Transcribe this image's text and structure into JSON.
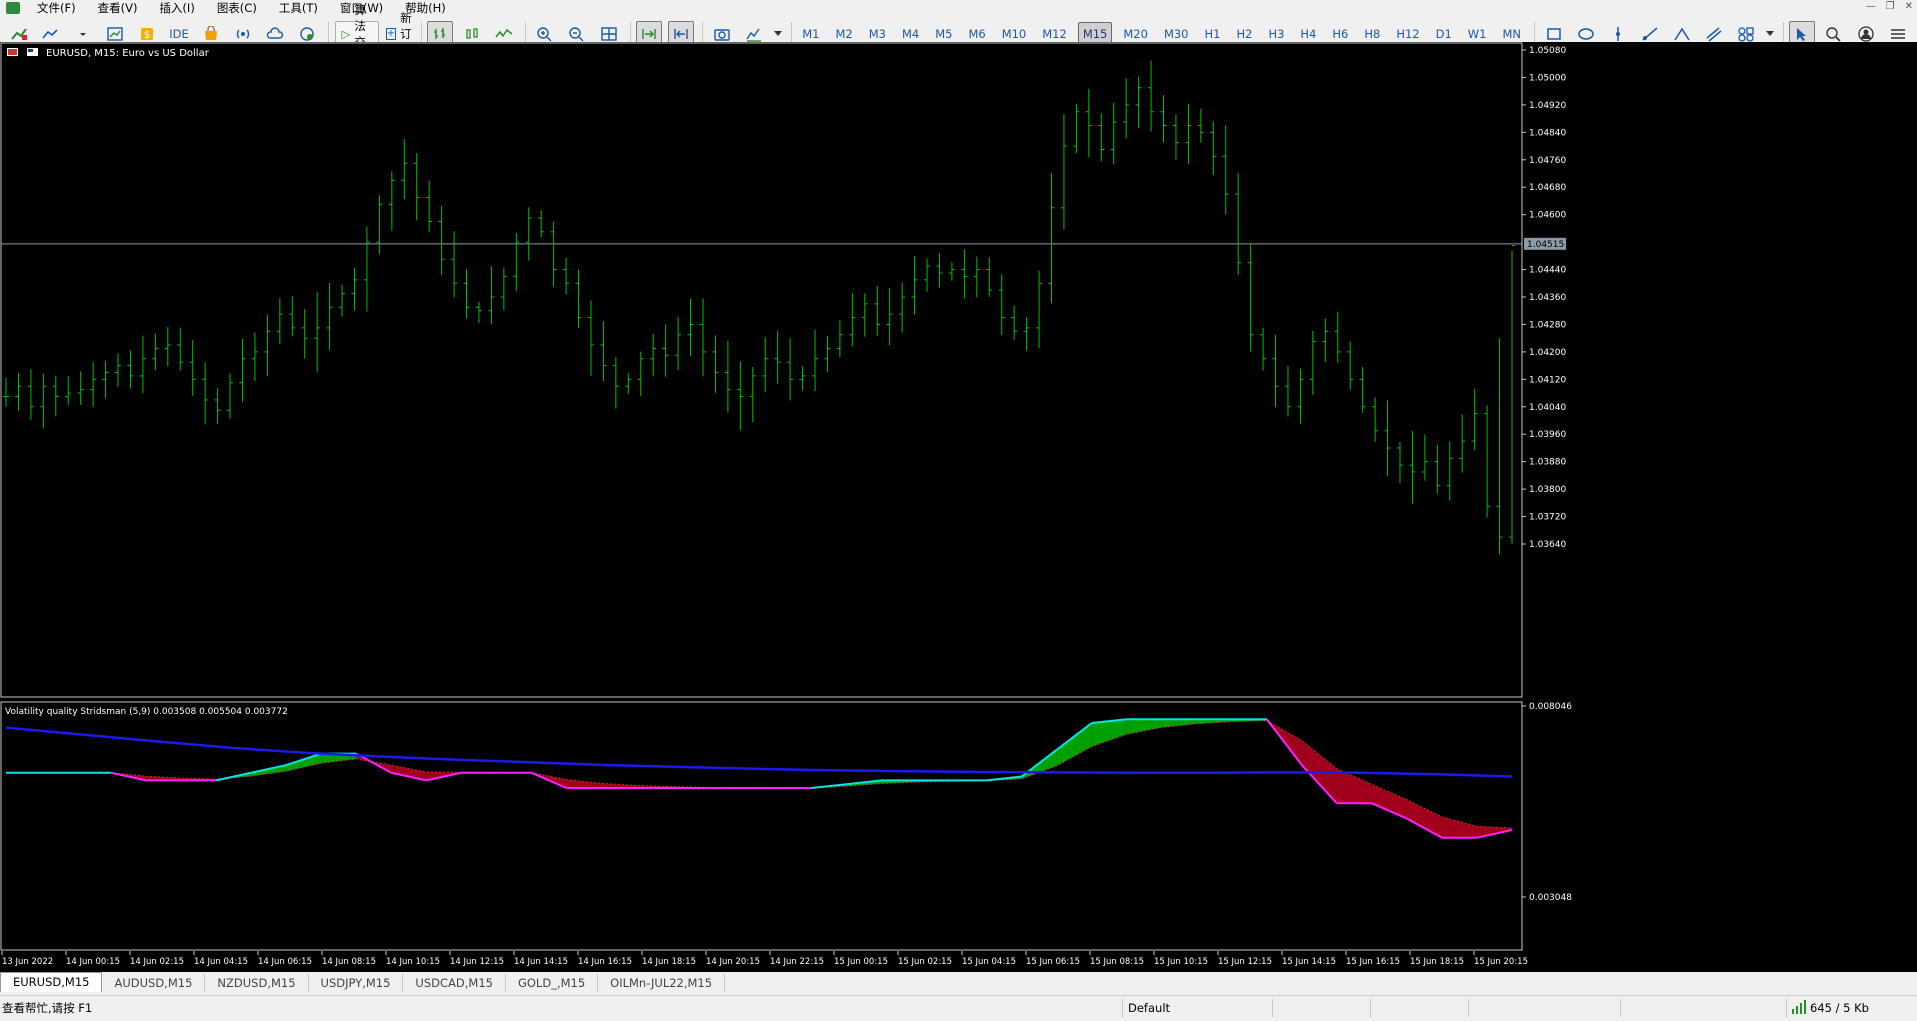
{
  "menu": [
    "文件(F)",
    "查看(V)",
    "插入(I)",
    "图表(C)",
    "工具(T)",
    "窗口(W)",
    "帮助(H)"
  ],
  "toolbar": {
    "ide_label": "IDE",
    "algo_label": "算法交易",
    "new_order_label": "新订单",
    "timeframes": [
      "M1",
      "M2",
      "M3",
      "M4",
      "M5",
      "M6",
      "M10",
      "M12",
      "M15",
      "M20",
      "M30",
      "H1",
      "H2",
      "H3",
      "H4",
      "H6",
      "H8",
      "H12",
      "D1",
      "W1",
      "MN"
    ],
    "active_timeframe": "M15"
  },
  "chart": {
    "title": "EURUSD, M15:  Euro vs US Dollar",
    "bid_line_label": "1.04515",
    "price_ticks": [
      "1.05080",
      "1.05000",
      "1.04920",
      "1.04840",
      "1.04760",
      "1.04680",
      "1.04600",
      "1.04440",
      "1.04360",
      "1.04280",
      "1.04200",
      "1.04120",
      "1.04040",
      "1.03960",
      "1.03880",
      "1.03800",
      "1.03720",
      "1.03640"
    ],
    "price_tick_values": [
      1.0508,
      1.05,
      1.0492,
      1.0484,
      1.0476,
      1.0468,
      1.046,
      1.0444,
      1.0436,
      1.0428,
      1.042,
      1.0412,
      1.0404,
      1.0396,
      1.0388,
      1.038,
      1.0372,
      1.0364
    ],
    "bid_value": 1.04515,
    "bar_color": "#00c000",
    "bid_line_color": "#8a9aa8"
  },
  "indicator": {
    "title": "Volatility quality Stridsman (5,9) 0.003508 0.005504 0.003772",
    "max_label": "0.008046",
    "min_label": "0.003048",
    "colors": {
      "ma_line": "#1a1af0",
      "up_line": "#00e5e5",
      "down_line": "#ff20ff",
      "up_fill": "#00a000",
      "down_fill": "#a0001a"
    }
  },
  "time_axis": [
    "13 Jun 2022",
    "14 Jun 00:15",
    "14 Jun 02:15",
    "14 Jun 04:15",
    "14 Jun 06:15",
    "14 Jun 08:15",
    "14 Jun 10:15",
    "14 Jun 12:15",
    "14 Jun 14:15",
    "14 Jun 16:15",
    "14 Jun 18:15",
    "14 Jun 20:15",
    "14 Jun 22:15",
    "15 Jun 00:15",
    "15 Jun 02:15",
    "15 Jun 04:15",
    "15 Jun 06:15",
    "15 Jun 08:15",
    "15 Jun 10:15",
    "15 Jun 12:15",
    "15 Jun 14:15",
    "15 Jun 16:15",
    "15 Jun 18:15",
    "15 Jun 20:15"
  ],
  "symbol_tabs": [
    "EURUSD,M15",
    "AUDUSD,M15",
    "NZDUSD,M15",
    "USDJPY,M15",
    "USDCAD,M15",
    "GOLD_,M15",
    "OILMn-JUL22,M15"
  ],
  "active_tab": 0,
  "status": {
    "help": "查看帮忙,请按 F1",
    "profile": "Default",
    "traffic": "645 / 5 Kb"
  },
  "chart_data": {
    "type": "ohlc",
    "series_color": "#00c000",
    "price_range": [
      1.0358,
      1.0512
    ],
    "bars_close": [
      1.0407,
      1.041,
      1.0404,
      1.041,
      1.0407,
      1.0408,
      1.0409,
      1.0412,
      1.0414,
      1.0416,
      1.0413,
      1.0418,
      1.0421,
      1.0422,
      1.0417,
      1.0412,
      1.0406,
      1.0403,
      1.0411,
      1.0418,
      1.042,
      1.0426,
      1.0431,
      1.0427,
      1.0424,
      1.0427,
      1.0433,
      1.0437,
      1.0441,
      1.0452,
      1.0463,
      1.047,
      1.0475,
      1.0465,
      1.0458,
      1.0447,
      1.044,
      1.0433,
      1.0432,
      1.0436,
      1.0442,
      1.0452,
      1.0459,
      1.0455,
      1.0444,
      1.044,
      1.043,
      1.0422,
      1.0416,
      1.041,
      1.0412,
      1.0418,
      1.0421,
      1.0419,
      1.0425,
      1.0428,
      1.042,
      1.0414,
      1.0409,
      1.0407,
      1.0413,
      1.0418,
      1.0417,
      1.0412,
      1.0413,
      1.0418,
      1.0421,
      1.0425,
      1.043,
      1.0434,
      1.0428,
      1.0431,
      1.0436,
      1.0441,
      1.0445,
      1.0443,
      1.0444,
      1.0442,
      1.0444,
      1.0438,
      1.043,
      1.0426,
      1.0427,
      1.044,
      1.0462,
      1.048,
      1.049,
      1.0486,
      1.0479,
      1.0487,
      1.0492,
      1.0497,
      1.049,
      1.0486,
      1.0481,
      1.0486,
      1.0484,
      1.0477,
      1.0466,
      1.0446,
      1.0425,
      1.0418,
      1.041,
      1.0404,
      1.0412,
      1.0423,
      1.0426,
      1.042,
      1.0412,
      1.0404,
      1.0397,
      1.0392,
      1.0387,
      1.0385,
      1.0388,
      1.0381,
      1.0389,
      1.0394,
      1.0402,
      1.0375,
      1.0366,
      1.0451
    ],
    "indicator_range": [
      0.003048,
      0.008046
    ],
    "indicator_ma": [
      0.00748,
      0.0073,
      0.00712,
      0.00695,
      0.00682,
      0.00672,
      0.00664,
      0.00657,
      0.0065,
      0.00645,
      0.0064,
      0.00636,
      0.00634,
      0.00632,
      0.00631,
      0.0063,
      0.0063,
      0.00631,
      0.0063,
      0.00626,
      0.0062
    ],
    "indicator_vq_samples": [
      0.0063,
      0.0063,
      0.0063,
      0.0063,
      0.0061,
      0.0061,
      0.0061,
      0.0063,
      0.0065,
      0.0068,
      0.0068,
      0.0063,
      0.0061,
      0.0063,
      0.0063,
      0.0063,
      0.0059,
      0.0059,
      0.0059,
      0.0059,
      0.0059,
      0.0059,
      0.0059,
      0.0059,
      0.006,
      0.0061,
      0.0061,
      0.0061,
      0.0061,
      0.0062,
      0.0069,
      0.0076,
      0.0077,
      0.0077,
      0.0077,
      0.0077,
      0.0077,
      0.0065,
      0.0055,
      0.0055,
      0.0051,
      0.0046,
      0.0046,
      0.0048
    ]
  }
}
